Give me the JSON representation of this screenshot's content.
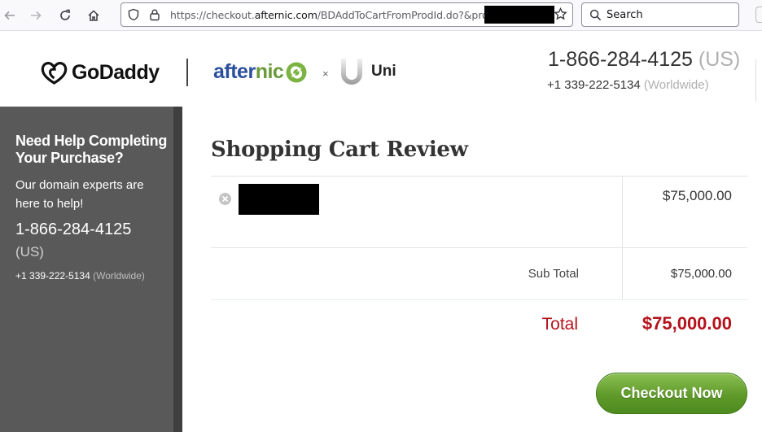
{
  "browser": {
    "url_prefix": "https://checkout.",
    "url_domain": "afternic.com",
    "url_path": "/BDAddToCartFromProdId.do?&prodId",
    "search_placeholder": "Search"
  },
  "header": {
    "godaddy_brand": "GoDaddy",
    "afternic_brand_part1": "after",
    "afternic_brand_part2": "nic",
    "times_symbol": "×",
    "uni_brand": "Uni",
    "phone_us": "1-866-284-4125",
    "phone_us_region": "(US)",
    "phone_ww": "+1 339-222-5134",
    "phone_ww_region": "(Worldwide)"
  },
  "sidebar": {
    "heading": "Need Help Completing Your Purchase?",
    "subtext": "Our domain experts are here to help!",
    "phone_us": "1-866-284-4125",
    "phone_us_region": "(US)",
    "phone_ww": "+1 339-222-5134",
    "phone_ww_region": "(Worldwide)"
  },
  "cart": {
    "title": "Shopping Cart Review",
    "items": [
      {
        "price": "$75,000.00"
      }
    ],
    "subtotal_label": "Sub Total",
    "subtotal_value": "$75,000.00",
    "total_label": "Total",
    "total_value": "$75,000.00",
    "checkout_label": "Checkout Now"
  },
  "colors": {
    "total_red": "#b5121b",
    "checkout_green": "#5f9a2a",
    "sidebar_gray": "#595959",
    "afternic_blue": "#2a4f9a"
  }
}
